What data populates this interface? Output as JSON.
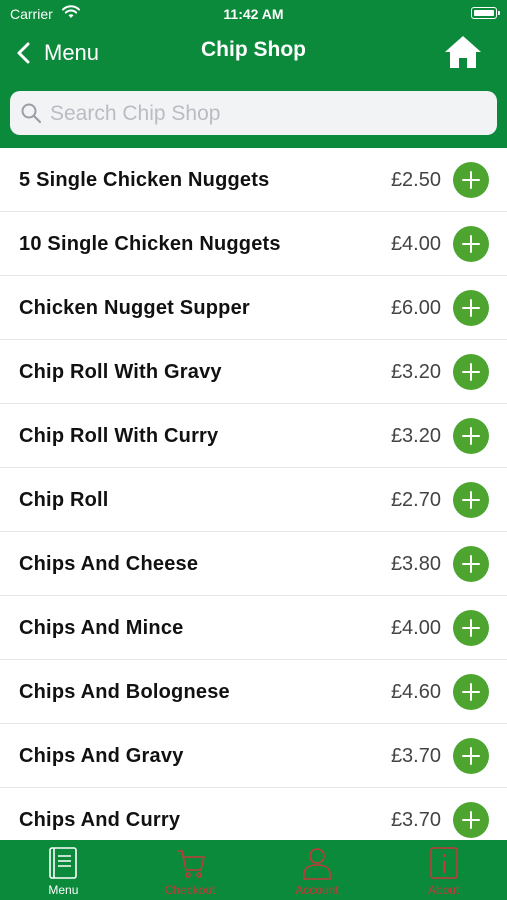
{
  "status_bar": {
    "carrier": "Carrier",
    "time": "11:42 AM"
  },
  "nav": {
    "back_label": "Menu",
    "title": "Chip Shop",
    "home_icon": "home-icon"
  },
  "search": {
    "placeholder": "Search Chip Shop",
    "value": ""
  },
  "items": [
    {
      "name": "5 Single Chicken Nuggets",
      "price": "£2.50"
    },
    {
      "name": "10 Single Chicken Nuggets",
      "price": "£4.00"
    },
    {
      "name": "Chicken Nugget Supper",
      "price": "£6.00"
    },
    {
      "name": "Chip Roll With Gravy",
      "price": "£3.20"
    },
    {
      "name": "Chip Roll With Curry",
      "price": "£3.20"
    },
    {
      "name": "Chip Roll",
      "price": "£2.70"
    },
    {
      "name": "Chips And Cheese",
      "price": "£3.80"
    },
    {
      "name": "Chips And Mince",
      "price": "£4.00"
    },
    {
      "name": "Chips And Bolognese",
      "price": "£4.60"
    },
    {
      "name": "Chips And Gravy",
      "price": "£3.70"
    },
    {
      "name": "Chips And Curry",
      "price": "£3.70"
    }
  ],
  "tabs": [
    {
      "label": "Menu",
      "icon": "menu-book-icon",
      "active": true
    },
    {
      "label": "Checkout",
      "icon": "cart-icon",
      "active": false
    },
    {
      "label": "Account",
      "icon": "person-icon",
      "active": false
    },
    {
      "label": "About",
      "icon": "info-icon",
      "active": false
    }
  ],
  "colors": {
    "brand_green": "#0a8a3a",
    "add_button": "#4da52f",
    "inactive_tab": "#c23a3a"
  }
}
